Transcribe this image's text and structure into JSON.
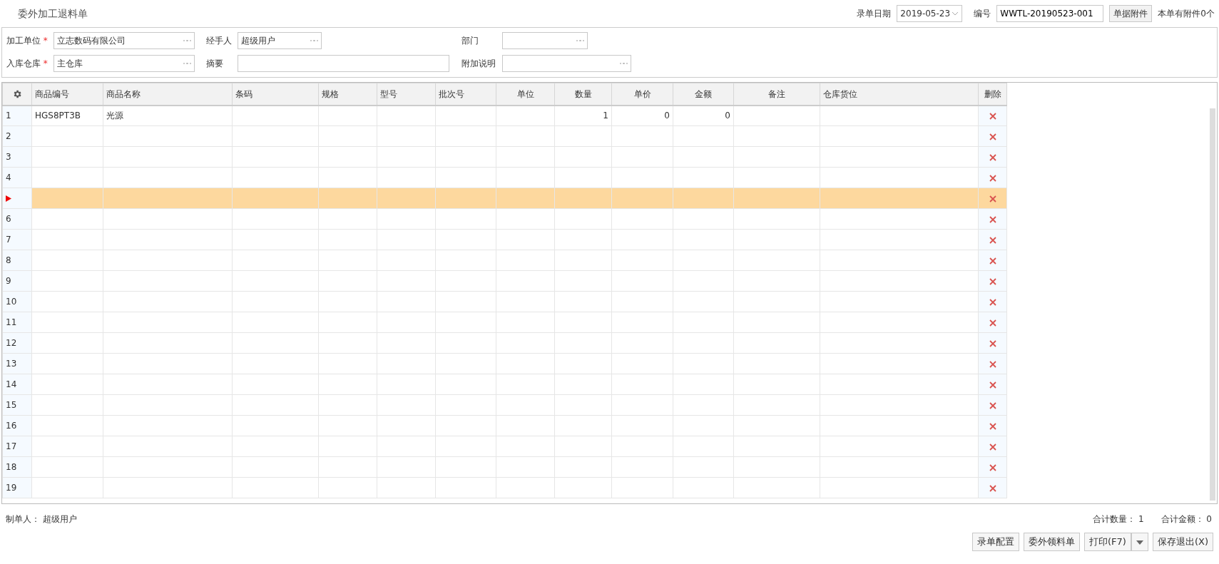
{
  "title": "委外加工退料单",
  "header": {
    "date_label": "录单日期",
    "date": "2019-05-23",
    "number_label": "编号",
    "number": "WWTL-20190523-001",
    "attach_button": "单据附件",
    "attach_note": "本单有附件0个"
  },
  "required_mark": "*",
  "form": [
    {
      "label": "加工单位",
      "required": true,
      "value": "立志数码有限公司",
      "kind": "picker"
    },
    {
      "label": "经手人",
      "required": false,
      "value": "超级用户",
      "kind": "picker"
    },
    {
      "label": "部门",
      "required": false,
      "kind": "picker"
    },
    {
      "label": "入库仓库",
      "required": true,
      "value": "主仓库",
      "kind": "picker"
    },
    {
      "label": "摘要",
      "required": false,
      "kind": "text"
    },
    {
      "label": "附加说明",
      "required": false,
      "kind": "picker"
    }
  ],
  "table": {
    "columns": [
      "商品编号",
      "商品名称",
      "条码",
      "规格",
      "型号",
      "批次号",
      "单位",
      "数量",
      "单价",
      "金额",
      "备注",
      "仓库货位",
      "删除"
    ],
    "rows": [
      {
        "number": "1",
        "selected": false,
        "cells": [
          "HGS8PT3B",
          "光源",
          "",
          "",
          "",
          "",
          "",
          "1",
          "0",
          "0",
          "",
          ""
        ]
      },
      {
        "number": "2",
        "selected": false
      },
      {
        "number": "3",
        "selected": false
      },
      {
        "number": "4",
        "selected": false
      },
      {
        "selected": true
      },
      {
        "number": "6",
        "selected": false
      },
      {
        "number": "7",
        "selected": false
      },
      {
        "number": "8",
        "selected": false
      },
      {
        "number": "9",
        "selected": false
      },
      {
        "number": "10",
        "selected": false
      },
      {
        "number": "11",
        "selected": false
      },
      {
        "number": "12",
        "selected": false
      },
      {
        "number": "13",
        "selected": false
      },
      {
        "number": "14",
        "selected": false
      },
      {
        "number": "15",
        "selected": false
      },
      {
        "number": "16",
        "selected": false
      },
      {
        "number": "17",
        "selected": false
      },
      {
        "number": "18",
        "selected": false
      },
      {
        "number": "19",
        "selected": false
      }
    ]
  },
  "footer": {
    "maker_label": "制单人：",
    "maker": "超级用户",
    "total_qty_label": "合计数量：",
    "total_qty": "1",
    "total_amount_label": "合计金额：",
    "total_amount": "0"
  },
  "buttons": [
    {
      "label": "录单配置",
      "kind": "plain"
    },
    {
      "label": "委外领料单",
      "kind": "plain"
    },
    {
      "label": "打印(F7)",
      "kind": "split"
    },
    {
      "label": "保存退出(X)",
      "kind": "plain"
    }
  ]
}
